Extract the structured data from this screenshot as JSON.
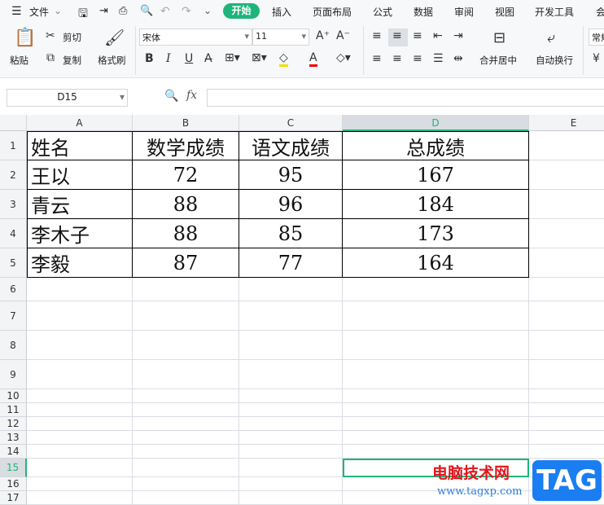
{
  "menu": {
    "file": "文件",
    "tabs": [
      "开始",
      "插入",
      "页面布局",
      "公式",
      "数据",
      "审阅",
      "视图",
      "开发工具",
      "会"
    ]
  },
  "ribbon": {
    "paste": "粘贴",
    "cut": "剪切",
    "copy": "复制",
    "format_painter": "格式刷",
    "font_name": "宋体",
    "font_size": "11",
    "merge_center": "合并居中",
    "wrap_text": "自动换行",
    "number_format": "常规",
    "currency": "¥"
  },
  "formula_bar": {
    "name_box": "D15",
    "fx": "fx",
    "value": ""
  },
  "columns": [
    "A",
    "B",
    "C",
    "D",
    "E"
  ],
  "rows": [
    "1",
    "2",
    "3",
    "4",
    "5",
    "6",
    "7",
    "8",
    "9",
    "10",
    "11",
    "12",
    "13",
    "14",
    "15",
    "16",
    "17"
  ],
  "table": {
    "header": [
      "姓名",
      "数学成绩",
      "语文成绩",
      "总成绩"
    ],
    "data": [
      [
        "王以",
        "72",
        "95",
        "167"
      ],
      [
        "青云",
        "88",
        "96",
        "184"
      ],
      [
        "李木子",
        "88",
        "85",
        "173"
      ],
      [
        "李毅",
        "87",
        "77",
        "164"
      ]
    ]
  },
  "watermark": {
    "site": "电脑技术网",
    "url": "www.tagxp.com",
    "logo": "TAG"
  },
  "colors": {
    "accent": "#1fb57a",
    "selected_header": "#d9dce1"
  }
}
